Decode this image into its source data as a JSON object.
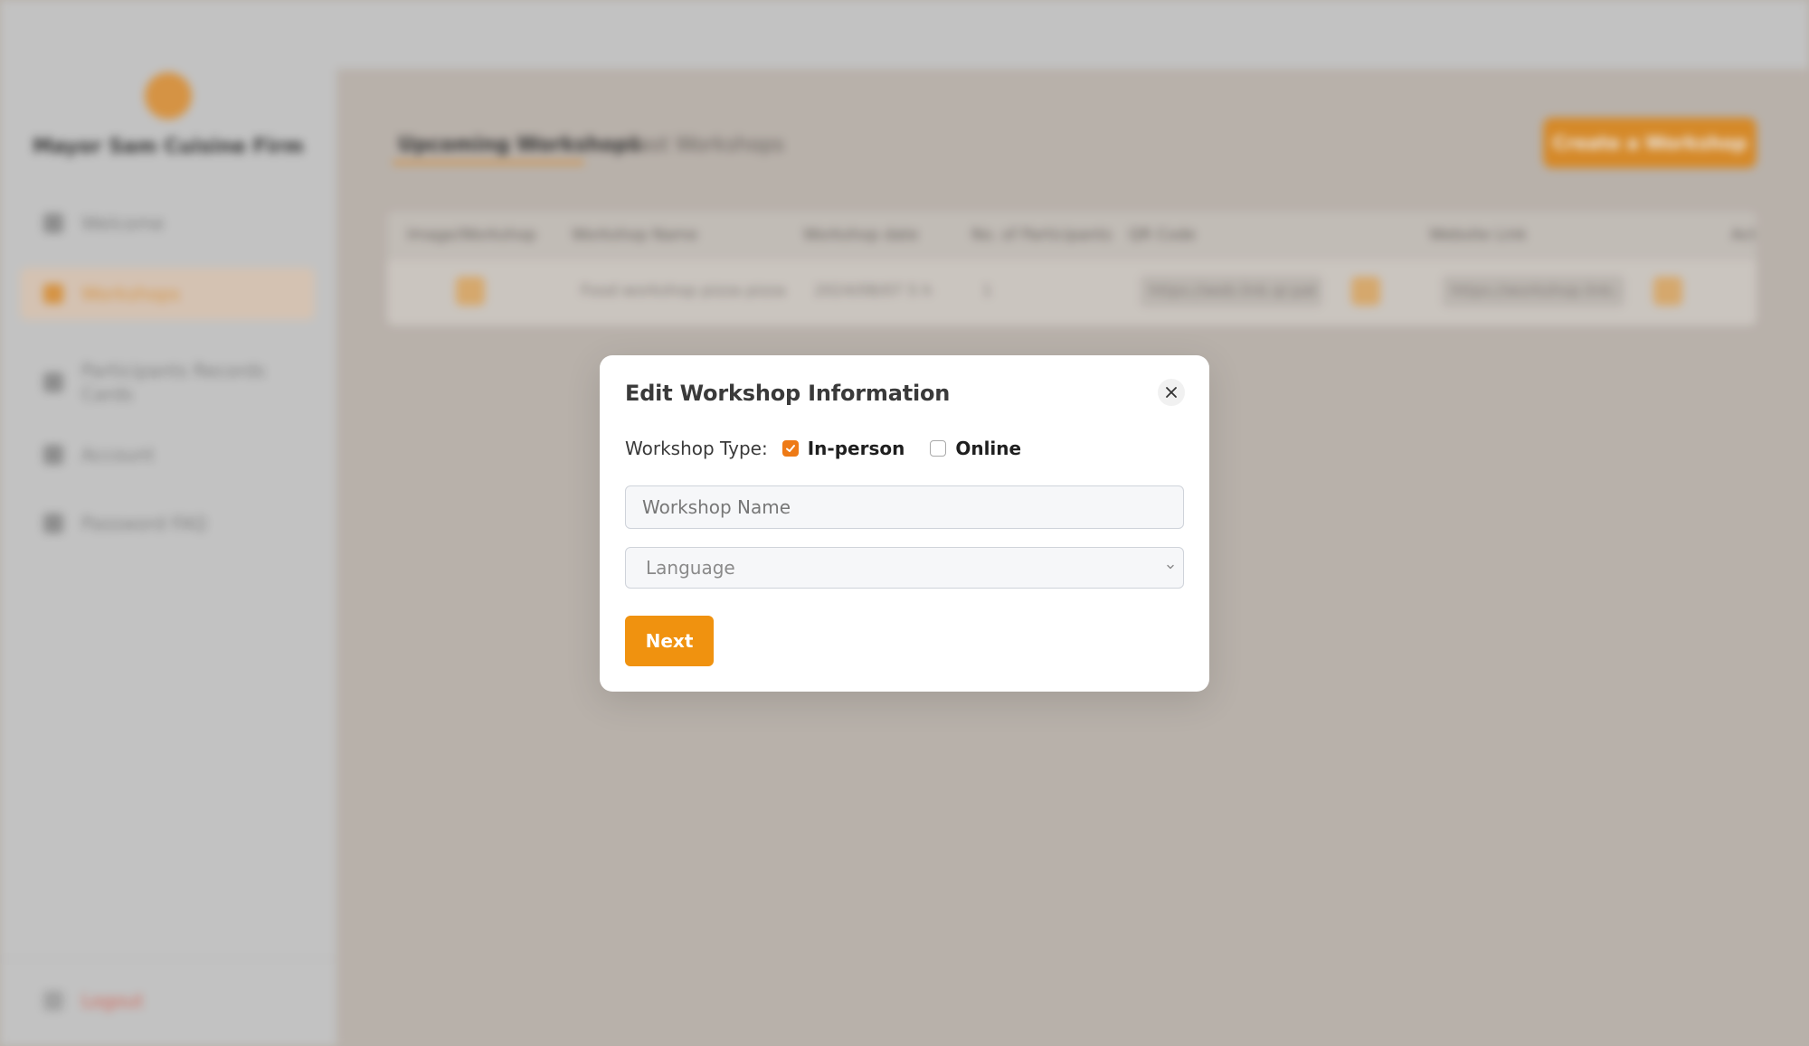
{
  "background": {
    "sidebar": {
      "brand": "Mayor Sam Cuisine Firm",
      "items": [
        {
          "label": "Welcome",
          "icon": "grid-icon",
          "active": false
        },
        {
          "label": "Workshops",
          "icon": "calendar-icon",
          "active": true
        },
        {
          "label": "Participants Records Cards",
          "icon": "pen-icon",
          "active": false
        },
        {
          "label": "Account",
          "icon": "user-icon",
          "active": false
        },
        {
          "label": "Password FAQ",
          "icon": "document-icon",
          "active": false
        }
      ],
      "logout": "Logout"
    },
    "tabs": [
      "Upcoming Workshops",
      "Past Workshops"
    ],
    "create_button": "Create a Workshop",
    "table": {
      "headers": [
        "Image/Workshop",
        "Workshop Name",
        "Workshop date",
        "No. of Participants",
        "QR Code",
        "Website Link",
        "Act"
      ],
      "row": [
        "Food workshop pizza pizza",
        "2024/08/07 5 h",
        "1",
        "https://web.link.qr.pattern",
        "https://workshop.link.info"
      ]
    }
  },
  "modal": {
    "title": "Edit Workshop Information",
    "type_label": "Workshop Type:",
    "options": [
      {
        "label": "In-person",
        "checked": true
      },
      {
        "label": "Online",
        "checked": false
      }
    ],
    "name_placeholder": "Workshop Name",
    "language_placeholder": "Language",
    "next_label": "Next",
    "accent_color": "#f0920f"
  }
}
